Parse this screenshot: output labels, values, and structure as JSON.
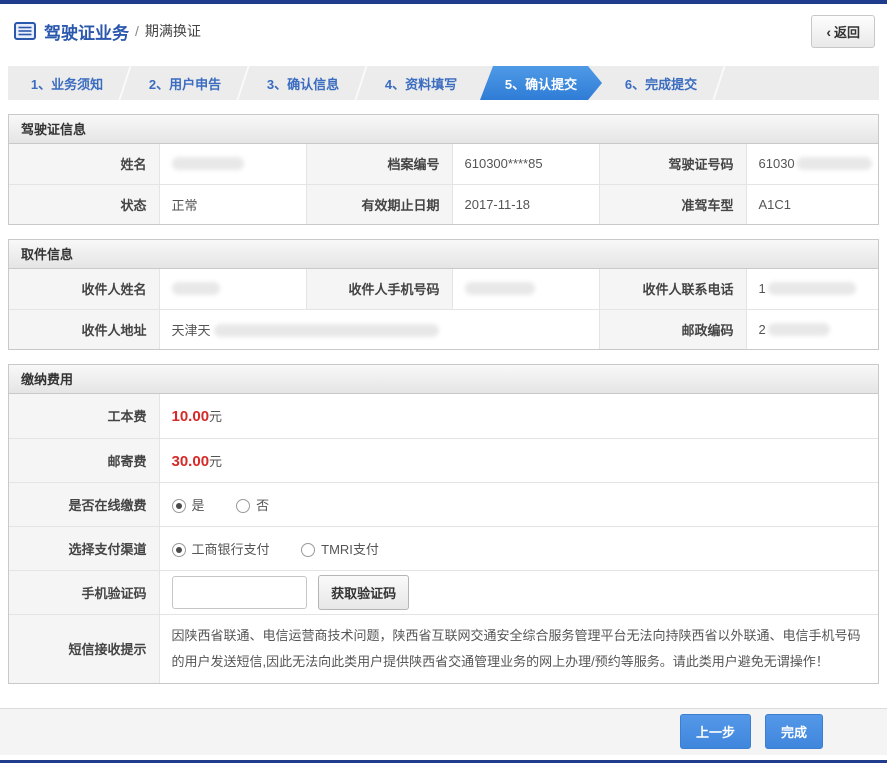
{
  "colors": {
    "brand_navy": "#203c8c",
    "accent_blue": "#3b87dd",
    "step_text_blue": "#3a6cc0",
    "title_blue": "#2b58ad",
    "price_red": "#d52a28",
    "warning_red": "#c0403e"
  },
  "header": {
    "icon": "list-icon",
    "title": "驾驶证业务",
    "separator": "/",
    "subtitle": "期满换证",
    "back_glyph": "‹",
    "back_label": "返回"
  },
  "steps": {
    "items": [
      "1、业务须知",
      "2、用户申告",
      "3、确认信息",
      "4、资料填写",
      "5、确认提交",
      "6、完成提交"
    ],
    "active": "5、确认提交"
  },
  "license": {
    "title": "驾驶证信息",
    "name_label": "姓名",
    "file_label": "档案编号",
    "file_value": "610300****85",
    "number_label": "驾驶证号码",
    "number_value_prefix": "61030",
    "status_label": "状态",
    "status_value": "正常",
    "expiry_label": "有效期止日期",
    "expiry_value": "2017-11-18",
    "vehicle_label": "准驾车型",
    "vehicle_value": "A1C1"
  },
  "pickup": {
    "title": "取件信息",
    "name_label": "收件人姓名",
    "mobile_label": "收件人手机号码",
    "phone_label": "收件人联系电话",
    "phone_value_prefix": "1",
    "address_label": "收件人地址",
    "address_value_prefix": "天津天",
    "zip_label": "邮政编码",
    "zip_value_prefix": "2"
  },
  "fees": {
    "title": "缴纳费用",
    "card_fee_label": "工本费",
    "card_fee_value": "10.00",
    "mail_fee_label": "邮寄费",
    "mail_fee_value": "30.00",
    "unit": "元",
    "online_label": "是否在线缴费",
    "online_yes": "是",
    "online_no": "否",
    "online_selected": "是",
    "channel_label": "选择支付渠道",
    "channel_icbc": "工商银行支付",
    "channel_tmri": "TMRI支付",
    "channel_selected": "工商银行支付",
    "code_label": "手机验证码",
    "code_button": "获取验证码",
    "sms_label": "短信接收提示",
    "sms_notice": "因陕西省联通、电信运营商技术问题，陕西省互联网交通安全综合服务管理平台无法向持陕西省以外联通、电信手机号码的用户发送短信,因此无法向此类用户提供陕西省交通管理业务的网上办理/预约等服务。请此类用户避免无谓操作！"
  },
  "footer": {
    "prev_button": "上一步",
    "done_button": "完成"
  }
}
